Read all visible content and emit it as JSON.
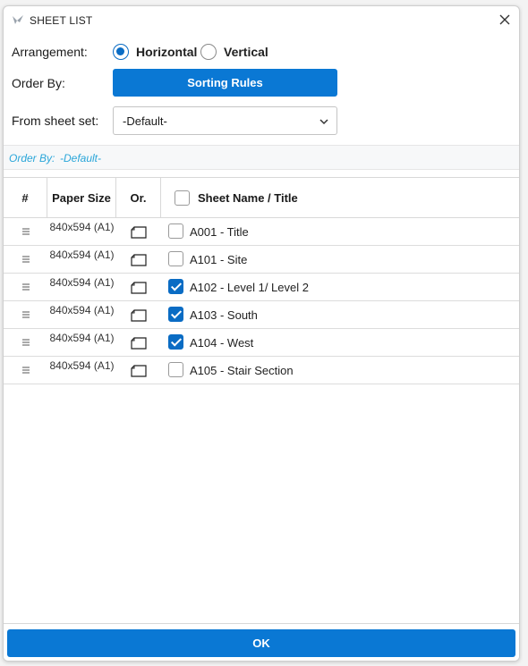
{
  "window": {
    "title": "SHEET LIST"
  },
  "arrangement": {
    "label": "Arrangement:",
    "options": [
      {
        "label": "Horizontal",
        "checked": true
      },
      {
        "label": "Vertical",
        "checked": false
      }
    ]
  },
  "order_by": {
    "label": "Order By:",
    "button_label": "Sorting Rules"
  },
  "sheet_set": {
    "label": "From sheet set:",
    "value": "-Default-"
  },
  "order_bar": {
    "key": "Order By:",
    "value": "-Default-"
  },
  "table": {
    "headers": {
      "num": "#",
      "paper_size": "Paper Size",
      "orientation": "Or.",
      "name": "Sheet Name / Title"
    },
    "rows": [
      {
        "paper_size": "840x594 (A1)",
        "name": "A001 - Title",
        "checked": false
      },
      {
        "paper_size": "840x594 (A1)",
        "name": "A101 - Site",
        "checked": false
      },
      {
        "paper_size": "840x594 (A1)",
        "name": "A102 - Level 1/ Level 2",
        "checked": true
      },
      {
        "paper_size": "840x594 (A1)",
        "name": "A103 - South",
        "checked": true
      },
      {
        "paper_size": "840x594 (A1)",
        "name": "A104 - West",
        "checked": true
      },
      {
        "paper_size": "840x594 (A1)",
        "name": "A105 - Stair Section",
        "checked": false
      }
    ]
  },
  "footer": {
    "ok_label": "OK"
  },
  "colors": {
    "accent": "#0a78d4",
    "order_bar_text": "#2aa6d9"
  },
  "icons": [
    "app-logo-icon",
    "close-icon",
    "chevron-down-icon",
    "drag-handle-icon",
    "landscape-sheet-icon"
  ]
}
